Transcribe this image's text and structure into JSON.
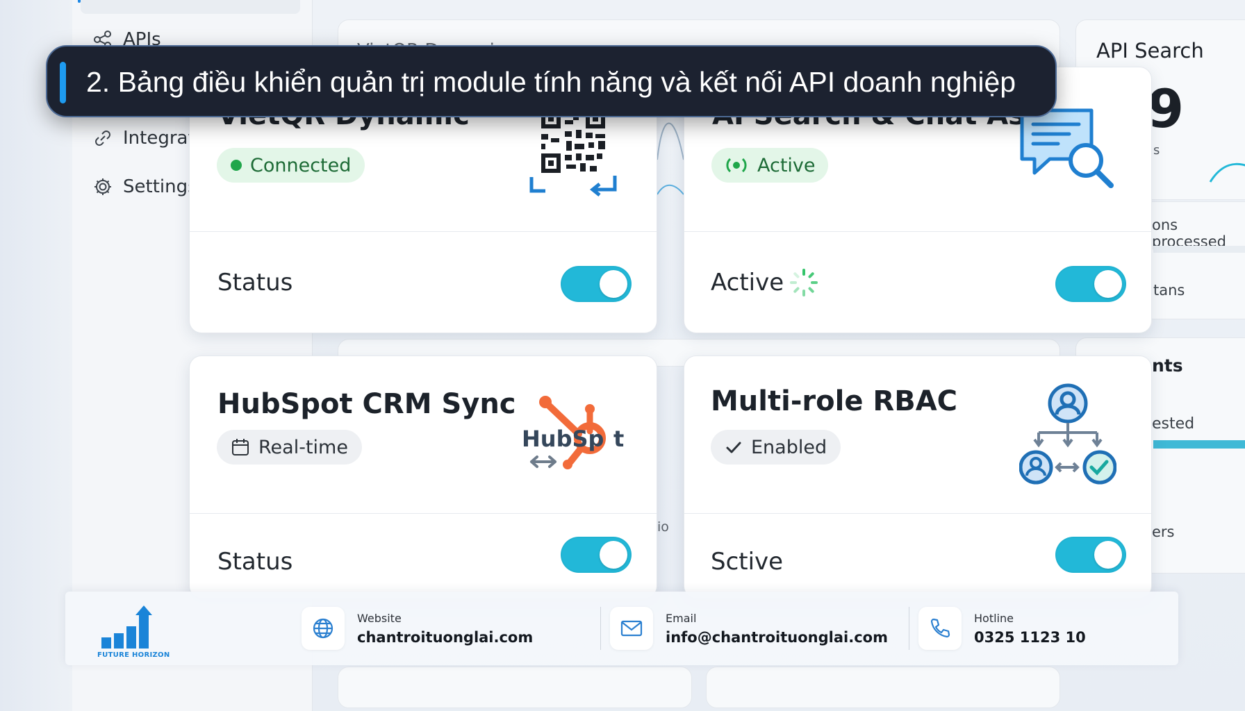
{
  "caption": {
    "text": "2. Bảng điều khiển quản trị module tính năng và kết nối API doanh nghiệp"
  },
  "sidebar": {
    "items": [
      {
        "label": "APIs",
        "icon": "share-nodes-icon"
      },
      {
        "label": "Integrat",
        "icon": "link-icon"
      },
      {
        "label": "Settings",
        "icon": "gear-icon"
      }
    ]
  },
  "background": {
    "card_title_ghost": "VietQR Dynamic",
    "right_card_title": "API Search",
    "right_card_big": "'9",
    "right_card_s": "s",
    "right_processed": "ons processed",
    "right_tans": "tans",
    "right_nts": "nts",
    "right_ested": "ested",
    "right_ers": "ers",
    "mid_io": "io"
  },
  "cards": [
    {
      "title": "VietQR Dynamic",
      "badge": "Connected",
      "badge_icon": "green-dot-icon",
      "illustration": "qr-code-icon",
      "row_label": "Status",
      "toggle_on": true
    },
    {
      "title": "AI Search & Chat Assi",
      "badge": "Active",
      "badge_icon": "broadcast-icon",
      "illustration": "chat-search-icon",
      "row_label": "Active",
      "row_icon": "loading-spinner-icon",
      "toggle_on": true
    },
    {
      "title": "HubSpot CRM Sync",
      "badge": "Real-time",
      "badge_icon": "calendar-icon",
      "illustration": "hubspot-logo",
      "logo_text": "HubSp",
      "logo_text_tail": "t",
      "row_label": "Status",
      "toggle_on": true
    },
    {
      "title": "Multi-role RBAC",
      "badge": "Enabled",
      "badge_icon": "check-icon",
      "illustration": "role-hierarchy-icon",
      "row_label": "Sctive",
      "toggle_on": true
    }
  ],
  "footer": {
    "brand": "FUTURE HORIZON",
    "website_label": "Website",
    "website_value": "chantroituonglai.com",
    "email_label": "Email",
    "email_value": "info@chantroituonglai.com",
    "hotline_label": "Hotline",
    "hotline_value": "0325 1123 10"
  },
  "colors": {
    "toggle": "#22b8d8",
    "caption_bg": "#1c2230",
    "caption_accent": "#1e9bf0",
    "connected_green": "#1fa64a",
    "hubspot_orange": "#f26b3a",
    "icon_blue": "#1f7fd0"
  }
}
